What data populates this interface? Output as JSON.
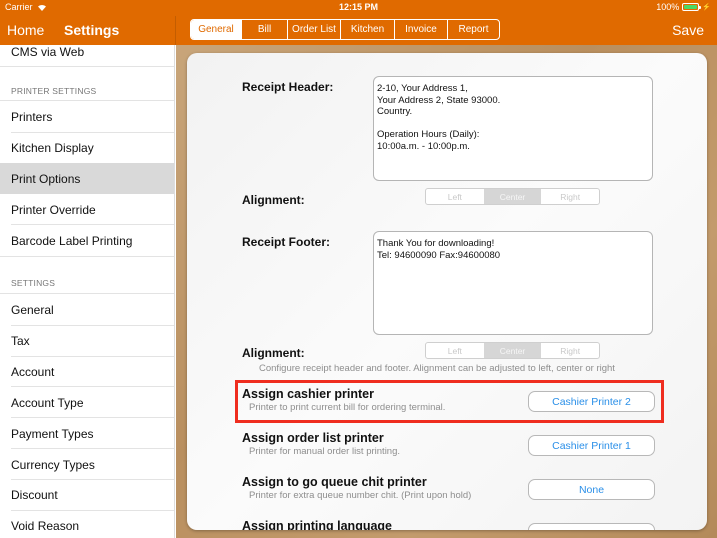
{
  "status_bar": {
    "carrier": "Carrier",
    "time": "12:15 PM",
    "battery_percent": "100%",
    "battery_level": 1.0
  },
  "nav": {
    "home_label": "Home",
    "title": "Settings",
    "save_label": "Save"
  },
  "tabs": [
    {
      "label": "General",
      "active": true
    },
    {
      "label": "Bill",
      "active": false
    },
    {
      "label": "Order List",
      "active": false
    },
    {
      "label": "Kitchen",
      "active": false
    },
    {
      "label": "Invoice",
      "active": false
    },
    {
      "label": "Report",
      "active": false
    }
  ],
  "sidebar": {
    "top_item": "CMS via Web",
    "printer_header": "PRINTER SETTINGS",
    "printer_items": [
      "Printers",
      "Kitchen Display",
      "Print Options",
      "Printer Override",
      "Barcode Label Printing"
    ],
    "selected_item": "Print Options",
    "settings_header": "SETTINGS",
    "settings_items": [
      "General",
      "Tax",
      "Account",
      "Account Type",
      "Payment Types",
      "Currency Types",
      "Discount",
      "Void Reason"
    ]
  },
  "main": {
    "receipt_header": {
      "label": "Receipt Header:",
      "value": "2-10, Your Address 1,\nYour Address 2, State 93000.\nCountry.\n\nOperation Hours (Daily):\n10:00a.m. - 10:00p.m."
    },
    "header_alignment": {
      "label": "Alignment:",
      "options": [
        "Left",
        "Center",
        "Right"
      ],
      "selected": "Center"
    },
    "receipt_footer": {
      "label": "Receipt Footer:",
      "value": "Thank You for downloading!\nTel: 94600090 Fax:94600080"
    },
    "footer_alignment": {
      "label": "Alignment:",
      "options": [
        "Left",
        "Center",
        "Right"
      ],
      "selected": "Center"
    },
    "help_text": "Configure receipt header and footer. Alignment can be adjusted to left, center or right",
    "options": [
      {
        "title": "Assign cashier printer",
        "subtitle": "Printer to print current bill for ordering terminal.",
        "value": "Cashier Printer 2",
        "highlighted": true
      },
      {
        "title": "Assign order list printer",
        "subtitle": "Printer for manual order list printing.",
        "value": "Cashier Printer 1",
        "highlighted": false
      },
      {
        "title": "Assign to go queue chit printer",
        "subtitle": "Printer for extra queue number chit. (Print upon hold)",
        "value": "None",
        "highlighted": false
      },
      {
        "title": "Assign printing language",
        "subtitle": "",
        "value": "",
        "highlighted": false
      }
    ]
  },
  "colors": {
    "brand": "#e06a00",
    "link": "#2a8fe8",
    "highlight_border": "#ef2d1f",
    "battery": "#4cd964"
  }
}
